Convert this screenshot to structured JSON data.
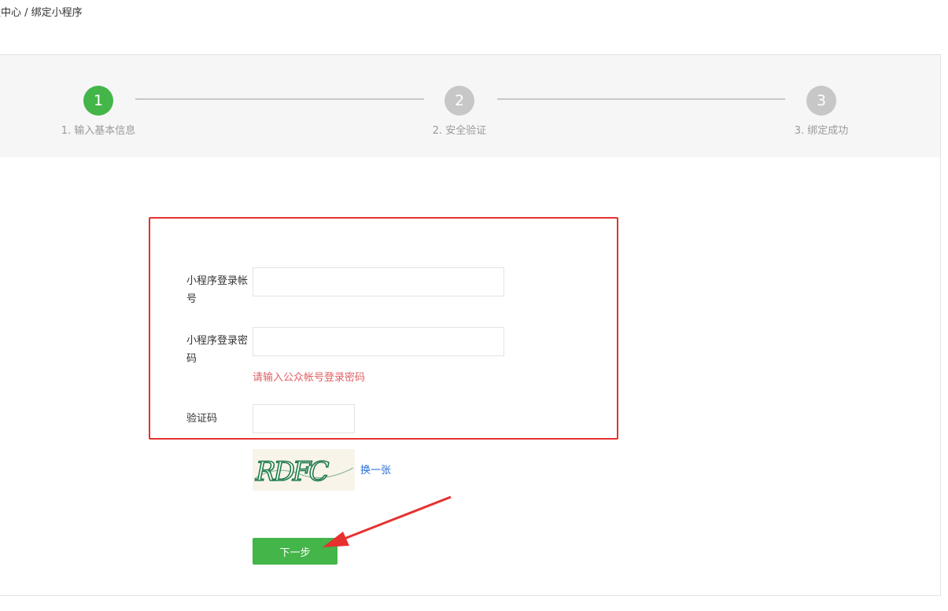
{
  "breadcrumb": "程中心 / 绑定小程序",
  "steps": [
    {
      "number": "1",
      "label": "1. 输入基本信息",
      "state": "active"
    },
    {
      "number": "2",
      "label": "2. 安全验证",
      "state": "pending"
    },
    {
      "number": "3",
      "label": "3. 绑定成功",
      "state": "pending"
    }
  ],
  "form": {
    "account_label": "小程序登录帐号",
    "account_value": "",
    "password_label": "小程序登录密码",
    "password_value": "",
    "password_error": "请输入公众帐号登录密码",
    "captcha_label": "验证码",
    "captcha_value": "",
    "captcha_text": "RDFC",
    "refresh_label": "换一张",
    "next_label": "下一步"
  },
  "colors": {
    "accent_green": "#44b549",
    "inactive_gray": "#c7c7c7",
    "error_red": "#e15f63",
    "link_blue": "#2a6ed8",
    "annotation_red": "#e6312f"
  }
}
